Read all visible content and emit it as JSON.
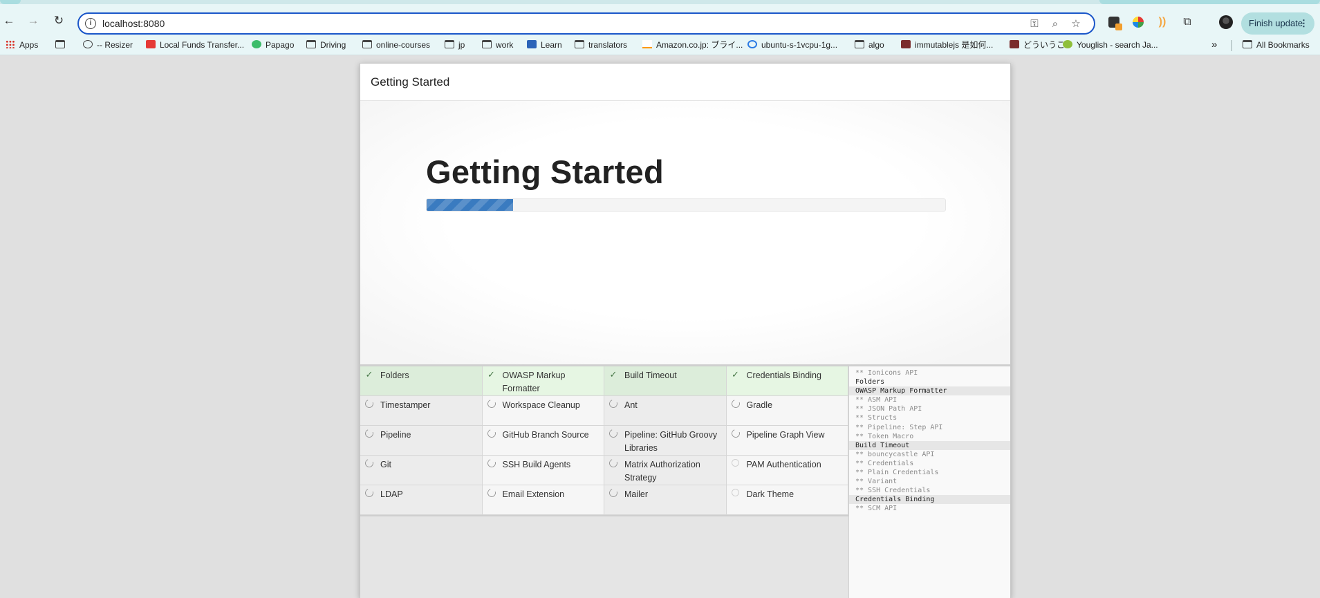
{
  "browser": {
    "url": "localhost:8080",
    "finish_update_label": "Finish update",
    "bookmarks": [
      {
        "label": "Apps",
        "icon": "apps-grid-icon"
      },
      {
        "label": "",
        "icon": "tab-groups-icon"
      },
      {
        "label": "-- Resizer",
        "icon": "globe-icon"
      },
      {
        "label": "Local Funds Transfer...",
        "icon": "bank-icon"
      },
      {
        "label": "Papago",
        "icon": "papago-icon"
      },
      {
        "label": "Driving",
        "icon": "folder-icon"
      },
      {
        "label": "online-courses",
        "icon": "folder-icon"
      },
      {
        "label": "jp",
        "icon": "folder-icon"
      },
      {
        "label": "work",
        "icon": "folder-icon"
      },
      {
        "label": "Learn",
        "icon": "learn-icon"
      },
      {
        "label": "translators",
        "icon": "folder-icon"
      },
      {
        "label": "Amazon.co.jp: ブライ...",
        "icon": "amazon-icon"
      },
      {
        "label": "ubuntu-s-1vcpu-1g...",
        "icon": "digitalocean-icon"
      },
      {
        "label": "algo",
        "icon": "folder-icon"
      },
      {
        "label": "immutablejs 是如何...",
        "icon": "site-icon"
      },
      {
        "label": "どういうこ",
        "icon": "site-icon"
      },
      {
        "label": "Youglish - search Ja...",
        "icon": "youglish-icon"
      }
    ],
    "overflow_label": "»",
    "all_bookmarks_label": "All Bookmarks"
  },
  "dialog": {
    "header_title": "Getting Started",
    "hero_title": "Getting Started",
    "progress_fraction": 0.167
  },
  "plugins": [
    {
      "name": "Folders",
      "status": "success"
    },
    {
      "name": "OWASP Markup Formatter",
      "status": "success"
    },
    {
      "name": "Build Timeout",
      "status": "success"
    },
    {
      "name": "Credentials Binding",
      "status": "success"
    },
    {
      "name": "Timestamper",
      "status": "installing"
    },
    {
      "name": "Workspace Cleanup",
      "status": "installing"
    },
    {
      "name": "Ant",
      "status": "installing"
    },
    {
      "name": "Gradle",
      "status": "installing"
    },
    {
      "name": "Pipeline",
      "status": "installing"
    },
    {
      "name": "GitHub Branch Source",
      "status": "installing"
    },
    {
      "name": "Pipeline: GitHub Groovy Libraries",
      "status": "installing"
    },
    {
      "name": "Pipeline Graph View",
      "status": "installing"
    },
    {
      "name": "Git",
      "status": "installing"
    },
    {
      "name": "SSH Build Agents",
      "status": "installing"
    },
    {
      "name": "Matrix Authorization Strategy",
      "status": "installing"
    },
    {
      "name": "PAM Authentication",
      "status": "pending"
    },
    {
      "name": "LDAP",
      "status": "installing"
    },
    {
      "name": "Email Extension",
      "status": "installing"
    },
    {
      "name": "Mailer",
      "status": "installing"
    },
    {
      "name": "Dark Theme",
      "status": "pending"
    }
  ],
  "log": [
    {
      "text": "** Ionicons API",
      "kind": "dep"
    },
    {
      "text": "Folders",
      "kind": "top"
    },
    {
      "text": "OWASP Markup Formatter",
      "kind": "top-sel"
    },
    {
      "text": "** ASM API",
      "kind": "dep"
    },
    {
      "text": "** JSON Path API",
      "kind": "dep"
    },
    {
      "text": "** Structs",
      "kind": "dep"
    },
    {
      "text": "** Pipeline: Step API",
      "kind": "dep"
    },
    {
      "text": "** Token Macro",
      "kind": "dep"
    },
    {
      "text": "Build Timeout",
      "kind": "top-sel"
    },
    {
      "text": "** bouncycastle API",
      "kind": "dep"
    },
    {
      "text": "** Credentials",
      "kind": "dep"
    },
    {
      "text": "** Plain Credentials",
      "kind": "dep"
    },
    {
      "text": "** Variant",
      "kind": "dep"
    },
    {
      "text": "** SSH Credentials",
      "kind": "dep"
    },
    {
      "text": "Credentials Binding",
      "kind": "top-sel"
    },
    {
      "text": "** SCM API",
      "kind": "dep"
    }
  ]
}
